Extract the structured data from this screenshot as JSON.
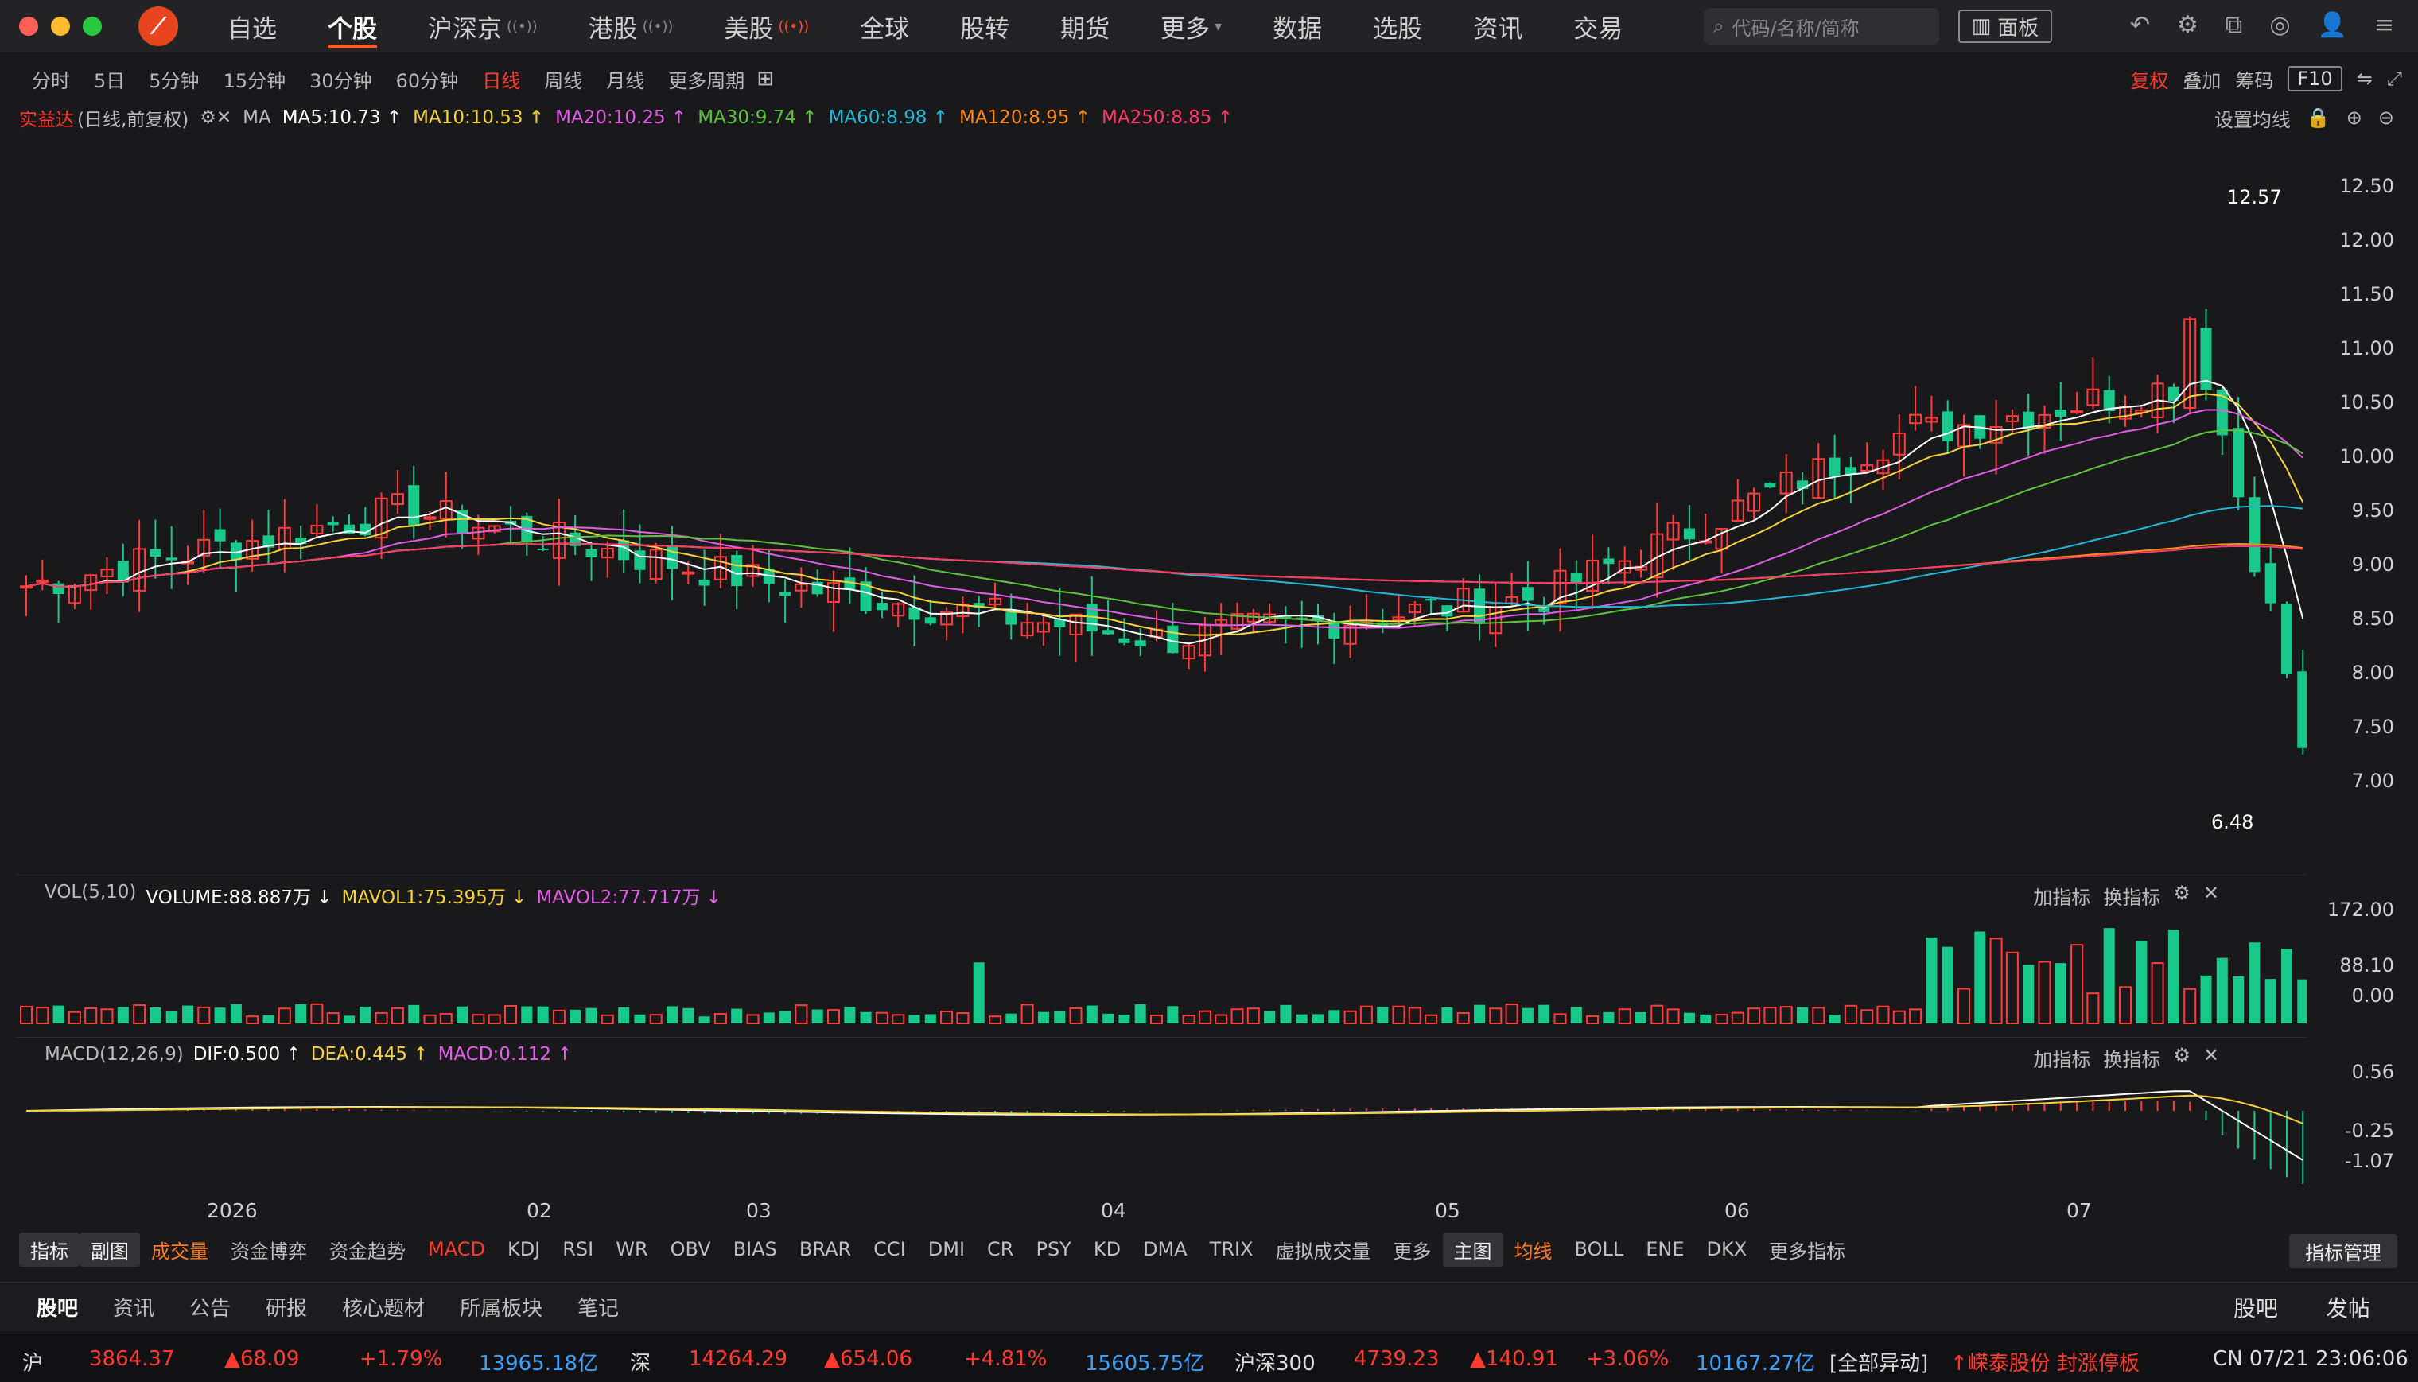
{
  "nav": {
    "items": [
      {
        "label": "自选",
        "signal": ""
      },
      {
        "label": "个股",
        "signal": ""
      },
      {
        "label": "沪深京",
        "signal": "((•))"
      },
      {
        "label": "港股",
        "signal": "((•))"
      },
      {
        "label": "美股",
        "signal": "((•))"
      },
      {
        "label": "全球",
        "signal": ""
      },
      {
        "label": "股转",
        "signal": ""
      },
      {
        "label": "期货",
        "signal": ""
      },
      {
        "label": "更多",
        "signal": "▾"
      },
      {
        "label": "数据",
        "signal": ""
      },
      {
        "label": "选股",
        "signal": ""
      },
      {
        "label": "资讯",
        "signal": ""
      },
      {
        "label": "交易",
        "signal": ""
      }
    ],
    "search_placeholder": "代码/名称/简称",
    "panel_label": "面板"
  },
  "periods": [
    "分时",
    "5日",
    "5分钟",
    "15分钟",
    "30分钟",
    "60分钟",
    "日线",
    "周线",
    "月线",
    "更多周期"
  ],
  "right_tools": {
    "fuquan": "复权",
    "diejia": "叠加",
    "chouma": "筹码",
    "f10": "F10"
  },
  "ma_legend": {
    "stock": "实益达",
    "mode": "(日线,前复权)",
    "ma_label": "MA",
    "items": [
      {
        "text": "MA5:10.73 ↑",
        "color": "#ffffff"
      },
      {
        "text": "MA10:10.53 ↑",
        "color": "#f7d23b"
      },
      {
        "text": "MA20:10.25 ↑",
        "color": "#e35de8"
      },
      {
        "text": "MA30:9.74 ↑",
        "color": "#5ec53a"
      },
      {
        "text": "MA60:8.98 ↑",
        "color": "#22b8d8"
      },
      {
        "text": "MA120:8.95 ↑",
        "color": "#ff8c1a"
      },
      {
        "text": "MA250:8.85 ↑",
        "color": "#ff3b6b"
      }
    ],
    "settings": "设置均线"
  },
  "main_axis": [
    "12.50",
    "12.00",
    "11.50",
    "11.00",
    "10.50",
    "10.00",
    "9.50",
    "9.00",
    "8.50",
    "8.00",
    "7.50",
    "7.00"
  ],
  "price_marks": {
    "high": "12.57",
    "low": "6.48"
  },
  "vol_pane": {
    "header": "VOL(5,10)",
    "volume": "VOLUME:88.887万 ↓",
    "mavol1": "MAVOL1:75.395万 ↓",
    "mavol2": "MAVOL2:77.717万 ↓",
    "axis": [
      "172.00",
      "88.10",
      "0.00"
    ]
  },
  "macd_pane": {
    "header": "MACD(12,26,9)",
    "dif": "DIF:0.500 ↑",
    "dea": "DEA:0.445 ↑",
    "macd": "MACD:0.112 ↑",
    "axis": [
      "0.56",
      "-0.25",
      "-1.07"
    ]
  },
  "pane_tools": {
    "add": "加指标",
    "swap": "换指标"
  },
  "xaxis": [
    "2026",
    "02",
    "03",
    "04",
    "05",
    "06",
    "07"
  ],
  "indicators": [
    "指标",
    "副图",
    "成交量",
    "资金博弈",
    "资金趋势",
    "MACD",
    "KDJ",
    "RSI",
    "WR",
    "OBV",
    "BIAS",
    "BRAR",
    "CCI",
    "DMI",
    "CR",
    "PSY",
    "KD",
    "DMA",
    "TRIX",
    "虚拟成交量",
    "更多",
    "主图",
    "均线",
    "BOLL",
    "ENE",
    "DKX",
    "更多指标"
  ],
  "indicator_manager": "指标管理",
  "bottom_tabs": [
    "股吧",
    "资讯",
    "公告",
    "研报",
    "核心题材",
    "所属板块",
    "笔记"
  ],
  "bottom_right": [
    "股吧",
    "发帖"
  ],
  "ticker": {
    "sh_label": "沪",
    "sh_value": "3864.37",
    "sh_change": "▲68.09",
    "sh_pct": "+1.79%",
    "sh_amount": "13965.18亿",
    "sz_label": "深",
    "sz_value": "14264.29",
    "sz_change": "▲654.06",
    "sz_pct": "+4.81%",
    "sz_amount": "15605.75亿",
    "hs_label": "沪深300",
    "hs_value": "4739.23",
    "hs_change": "▲140.91",
    "hs_pct": "+3.06%",
    "hs_amount": "10167.27亿",
    "alert_type": "[全部异动]",
    "alert": "↑嵘泰股份 封涨停板",
    "clock": "CN 07/21 23:06:06"
  },
  "chart_data": {
    "type": "candlestick",
    "title": "实益达 (日线,前复权)",
    "period": "daily",
    "x_range": [
      "2026-01",
      "2026-07"
    ],
    "ylim": [
      6.48,
      12.57
    ],
    "series_summary": [
      {
        "month": "01",
        "approx_close": 8.7
      },
      {
        "month": "02",
        "approx_close": 9.4
      },
      {
        "month": "03",
        "approx_close": 8.7
      },
      {
        "month": "04",
        "approx_close": 8.2
      },
      {
        "month": "05",
        "approx_close": 8.6
      },
      {
        "month": "06",
        "approx_close": 10.2
      },
      {
        "month": "07",
        "approx_close": 7.1
      }
    ],
    "ma": {
      "MA5": 10.73,
      "MA10": 10.53,
      "MA20": 10.25,
      "MA30": 9.74,
      "MA60": 8.98,
      "MA120": 8.95,
      "MA250": 8.85
    },
    "volume_ylim": [
      0,
      172
    ],
    "macd_ylim": [
      -1.07,
      0.56
    ]
  }
}
